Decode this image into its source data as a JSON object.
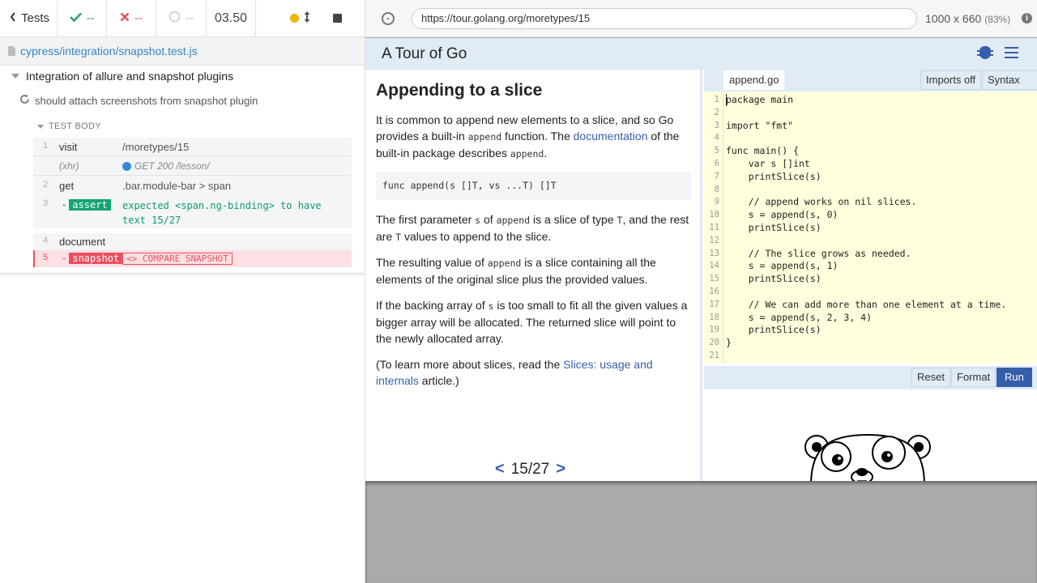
{
  "runner": {
    "tests_label": "Tests",
    "passed": "--",
    "failed": "--",
    "pending": "--",
    "duration": "03.50",
    "spec_path": "cypress/integration/snapshot.test.js",
    "suite_title": "Integration of allure and snapshot plugins",
    "test_title": "should attach screenshots from snapshot plugin",
    "test_body_label": "TEST BODY",
    "commands": [
      {
        "num": "1",
        "name": "visit",
        "message": "/moretypes/15"
      },
      {
        "num": "",
        "name": "(xhr)",
        "message": "GET 200 /lesson/"
      },
      {
        "num": "2",
        "name": "get",
        "message": ".bar.module-bar > span"
      },
      {
        "num": "3",
        "name": "-",
        "badge": "assert",
        "message": "expected <span.ng-binding> to have text 15/27"
      },
      {
        "num": "4",
        "name": "document",
        "message": ""
      },
      {
        "num": "5",
        "name": "-",
        "badge": "snapshot",
        "message": "<> COMPARE SNAPSHOT"
      }
    ]
  },
  "browser": {
    "url": "https://tour.golang.org/moretypes/15",
    "viewport": "1000 x 660",
    "zoom": "(83%)",
    "info_glyph": "i"
  },
  "tour": {
    "title": "A Tour of Go",
    "lesson": {
      "title": "Appending to a slice",
      "p1_a": "It is common to append new elements to a slice, and so Go provides a built-in ",
      "p1_code": "append",
      "p1_b": " function. The ",
      "p1_link": "documentation",
      "p1_c": " of the built-in package describes ",
      "p1_code2": "append",
      "p1_d": ".",
      "signature": "func append(s []T, vs ...T) []T",
      "p2_a": "The first parameter ",
      "p2_code": "s",
      "p2_b": " of ",
      "p2_code2": "append",
      "p2_c": " is a slice of type ",
      "p2_code3": "T",
      "p2_d": ", and the rest are ",
      "p2_code4": "T",
      "p2_e": " values to append to the slice.",
      "p3_a": "The resulting value of ",
      "p3_code": "append",
      "p3_b": " is a slice containing all the elements of the original slice plus the provided values.",
      "p4_a": "If the backing array of ",
      "p4_code": "s",
      "p4_b": " is too small to fit all the given values a bigger array will be allocated. The returned slice will point to the newly allocated array.",
      "p5_a": "(To learn more about slices, read the ",
      "p5_link": "Slices: usage and internals",
      "p5_b": " article.)"
    },
    "pager": {
      "prev": "<",
      "page": "15/27",
      "next": ">"
    },
    "editor": {
      "file_tab": "append.go",
      "imports_btn": "Imports off",
      "syntax_btn": "Syntax off",
      "code_lines": [
        "package main",
        "",
        "import \"fmt\"",
        "",
        "func main() {",
        "    var s []int",
        "    printSlice(s)",
        "",
        "    // append works on nil slices.",
        "    s = append(s, 0)",
        "    printSlice(s)",
        "",
        "    // The slice grows as needed.",
        "    s = append(s, 1)",
        "    printSlice(s)",
        "",
        "    // We can add more than one element at a time.",
        "    s = append(s, 2, 3, 4)",
        "    printSlice(s)",
        "}",
        ""
      ],
      "reset_btn": "Reset",
      "format_btn": "Format",
      "run_btn": "Run"
    }
  },
  "colors": {
    "go_blue": "#375eab",
    "pass_green": "#2fa36e",
    "fail_red": "#e94f5f",
    "editor_bg": "#ffffdd",
    "header_bg": "#e0ebf5"
  }
}
